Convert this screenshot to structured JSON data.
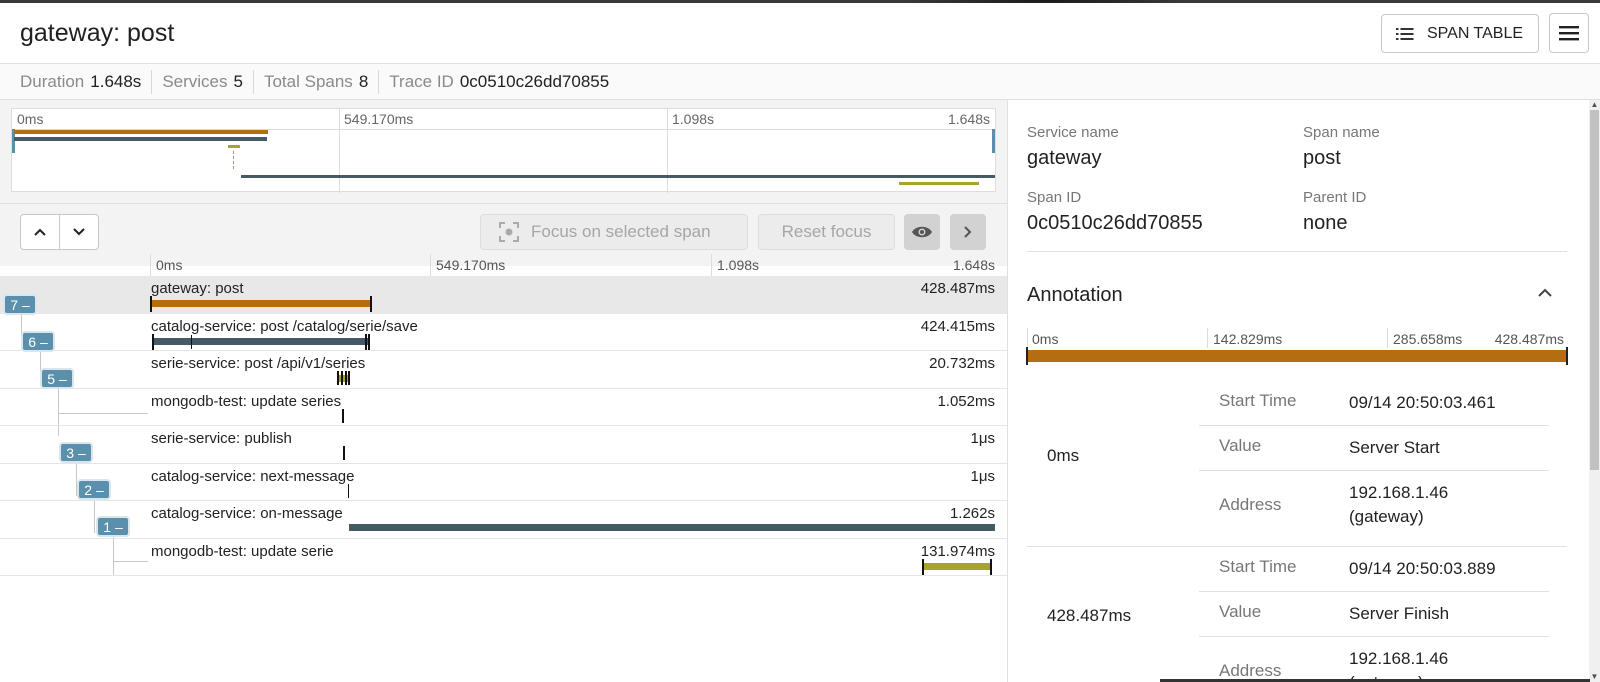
{
  "header": {
    "title": "gateway: post",
    "span_table_label": "SPAN TABLE"
  },
  "stats": [
    {
      "label": "Duration",
      "value": "1.648s"
    },
    {
      "label": "Services",
      "value": "5"
    },
    {
      "label": "Total Spans",
      "value": "8"
    },
    {
      "label": "Trace ID",
      "value": "0c0510c26dd70855"
    }
  ],
  "minimap": {
    "ticks": [
      "0ms",
      "549.170ms",
      "1.098s",
      "1.648s"
    ]
  },
  "toolbar": {
    "focus_label": "Focus on selected span",
    "reset_label": "Reset focus"
  },
  "timeline": {
    "ticks": [
      "0ms",
      "549.170ms",
      "1.098s",
      "1.648s"
    ]
  },
  "spans": [
    {
      "name": "gateway: post",
      "duration": "428.487ms",
      "color": "#b46e0f",
      "badge": "7 –"
    },
    {
      "name": "catalog-service: post /catalog/serie/save",
      "duration": "424.415ms",
      "color": "#455a64",
      "badge": "6 –"
    },
    {
      "name": "serie-service: post /api/v1/series",
      "duration": "20.732ms",
      "color": "#a8a32a",
      "badge": "5 –"
    },
    {
      "name": "mongodb-test: update series",
      "duration": "1.052ms",
      "color": "#a8a32a",
      "badge": ""
    },
    {
      "name": "serie-service: publish",
      "duration": "1μs",
      "color": "#a8a32a",
      "badge": "3 –"
    },
    {
      "name": "catalog-service: next-message",
      "duration": "1μs",
      "color": "#455a64",
      "badge": "2 –"
    },
    {
      "name": "catalog-service: on-message",
      "duration": "1.262s",
      "color": "#455a64",
      "badge": "1 –"
    },
    {
      "name": "mongodb-test: update serie",
      "duration": "131.974ms",
      "color": "#a8a32a",
      "badge": ""
    }
  ],
  "detail": {
    "service_name_label": "Service name",
    "service_name": "gateway",
    "span_name_label": "Span name",
    "span_name": "post",
    "span_id_label": "Span ID",
    "span_id": "0c0510c26dd70855",
    "parent_id_label": "Parent ID",
    "parent_id": "none",
    "annotation_title": "Annotation",
    "ann_ticks": [
      "0ms",
      "142.829ms",
      "285.658ms",
      "428.487ms"
    ],
    "events": [
      {
        "time": "0ms",
        "start_time_label": "Start Time",
        "start_time": "09/14 20:50:03.461",
        "value_label": "Value",
        "value": "Server Start",
        "address_label": "Address",
        "address_line1": "192.168.1.46",
        "address_line2": "(gateway)"
      },
      {
        "time": "428.487ms",
        "start_time_label": "Start Time",
        "start_time": "09/14 20:50:03.889",
        "value_label": "Value",
        "value": "Server Finish",
        "address_label": "Address",
        "address_line1": "192.168.1.46",
        "address_line2": "(gateway)"
      }
    ]
  }
}
